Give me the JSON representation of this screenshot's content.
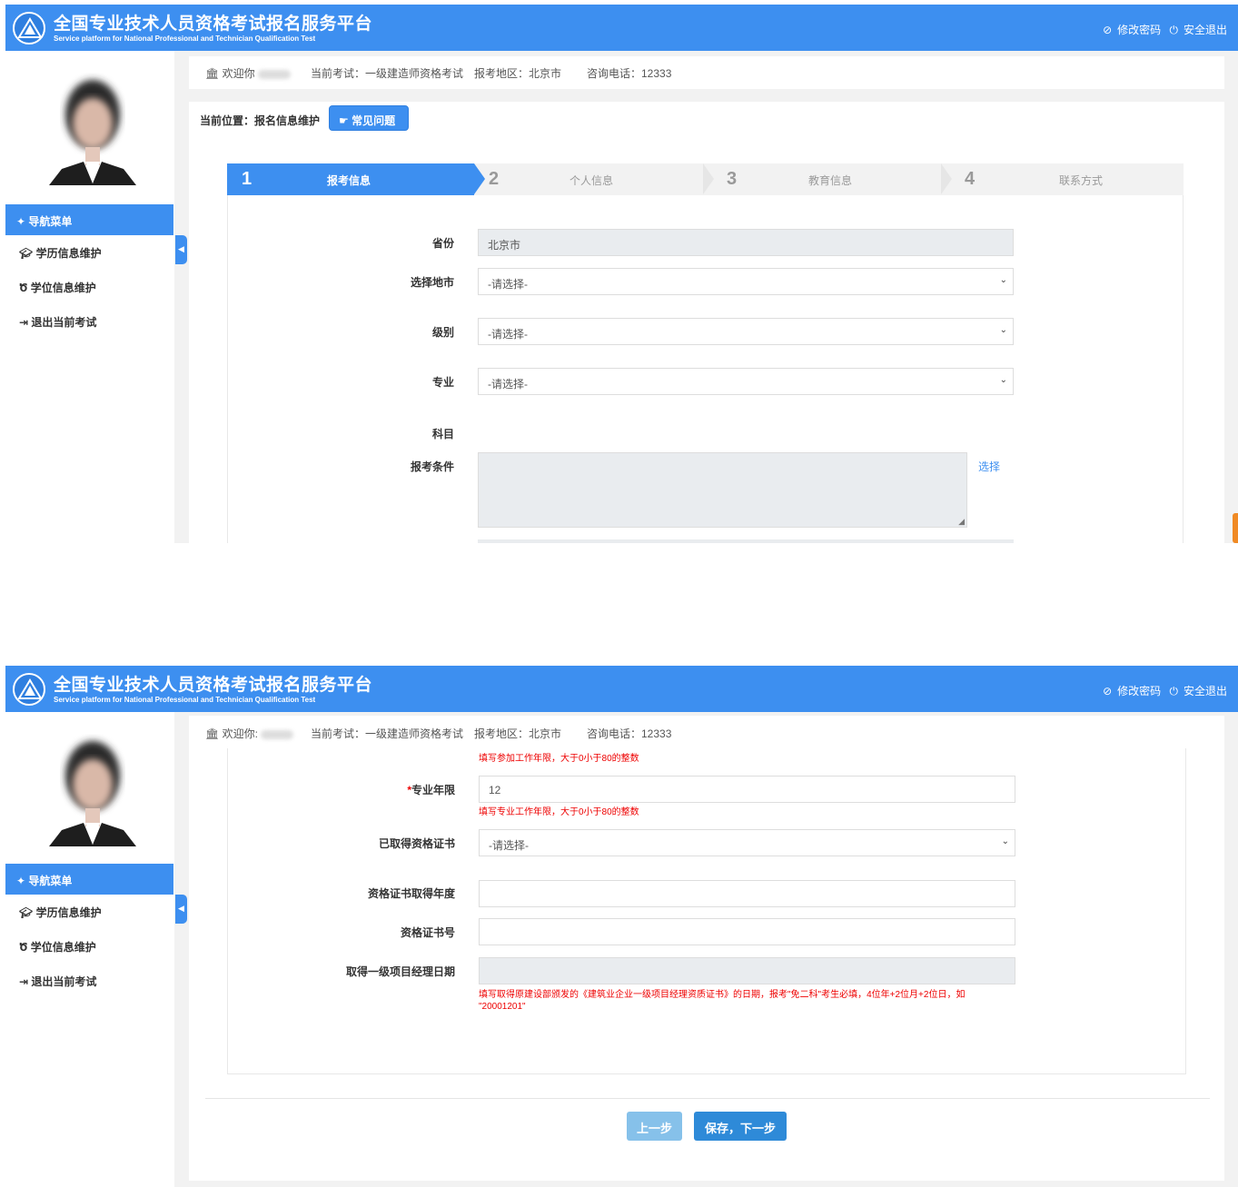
{
  "header": {
    "title_cn": "全国专业技术人员资格考试报名服务平台",
    "title_en": "Service platform for National Professional and Technician Qualification Test",
    "change_password": "修改密码",
    "logout": "安全退出",
    "bg_color": "#3d8ff0"
  },
  "sidebar": {
    "nav_title": "导航菜单",
    "items": [
      {
        "label": "学历信息维护",
        "icon": "graduation-cap-icon"
      },
      {
        "label": "学位信息维护",
        "icon": "degree-icon"
      },
      {
        "label": "退出当前考试",
        "icon": "exit-icon"
      }
    ]
  },
  "infobar": {
    "welcome": "欢迎你",
    "welcome2": "欢迎你:",
    "current_exam": "当前考试：一级建造师资格考试",
    "region": "报考地区：北京市",
    "phone": "咨询电话：12333"
  },
  "breadcrumb": {
    "label": "当前位置：报名信息维护",
    "faq": "常见问题"
  },
  "steps": [
    {
      "num": "1",
      "label": "报考信息"
    },
    {
      "num": "2",
      "label": "个人信息"
    },
    {
      "num": "3",
      "label": "教育信息"
    },
    {
      "num": "4",
      "label": "联系方式"
    }
  ],
  "form1": {
    "province_label": "省份",
    "province_value": "北京市",
    "city_label": "选择地市",
    "city_value": "-请选择-",
    "level_label": "级别",
    "level_value": "-请选择-",
    "major_label": "专业",
    "major_value": "-请选择-",
    "subject_label": "科目",
    "condition_label": "报考条件",
    "choose_link": "选择"
  },
  "form2": {
    "work_years_hint": "填写参加工作年限，大于0小于80的整数",
    "major_years_label": "专业年限",
    "major_years_value": "12",
    "major_years_hint": "填写专业工作年限，大于0小于80的整数",
    "cert_label": "已取得资格证书",
    "cert_value": "-请选择-",
    "cert_year_label": "资格证书取得年度",
    "cert_no_label": "资格证书号",
    "pm_date_label": "取得一级项目经理日期",
    "pm_date_hint_1": "填写取得原建设部颁发的《建筑业企业一级项目经理资质证书》的日期，报考\"免二科\"考生必填，4位年+2位月+2位日，如",
    "pm_date_hint_2": "\"20001201\""
  },
  "buttons": {
    "prev": "上一步",
    "save_next": "保存，下一步"
  }
}
